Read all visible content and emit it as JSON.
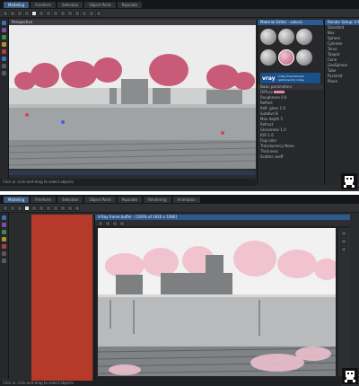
{
  "screenshot_a": {
    "tabs": [
      "Modeling",
      "Freeform",
      "Selection",
      "Object Paint",
      "Populate"
    ],
    "viewport_label": "Perspective",
    "render_setup_title": "Render Setup: V-Ray Adv",
    "material_editor": {
      "title": "Material Editor - sakura",
      "vray_brand": "vray",
      "shader_label": "V-Ray PowerShader",
      "shader_sublabel": "optimized for V-Ray",
      "basic_params_title": "Basic parameters",
      "rows": [
        "Diffuse",
        "Roughness 0.0",
        "Reflect",
        "Refl. gloss 1.0",
        "Subdivs 8",
        "Max depth 5",
        "Refract",
        "Glossiness 1.0",
        "IOR 1.6",
        "Fog color",
        "Translucency None",
        "Thickness",
        "Scatter coeff"
      ],
      "diffuse_color": "#e58aa6",
      "selected_ball_color": "#d9799a"
    },
    "side_list": [
      "Standard",
      "Box",
      "Sphere",
      "Cylinder",
      "Torus",
      "Teapot",
      "Cone",
      "GeoSphere",
      "Tube",
      "Pyramid",
      "Plane"
    ],
    "status_text": "Click or click-and-drag to select objects",
    "blossom_color": "#c75b78"
  },
  "screenshot_b": {
    "tabs": [
      "Modeling",
      "Freeform",
      "Selection",
      "Object Paint",
      "Populate",
      "Rendering",
      "Animation"
    ],
    "frame_buffer_title": "V-Ray frame buffer - [100% of 1920 x 1080]",
    "swatch_color": "#b63a2a",
    "status_text": "Click or click-and-drag to select objects",
    "blossom_color": "#f1c3cf"
  },
  "colors": {
    "accent_blue": "#2e5b8f",
    "panel_bg": "#26282b",
    "toolbar_bg": "#2f3135"
  },
  "icons": [
    "logo-icon"
  ]
}
